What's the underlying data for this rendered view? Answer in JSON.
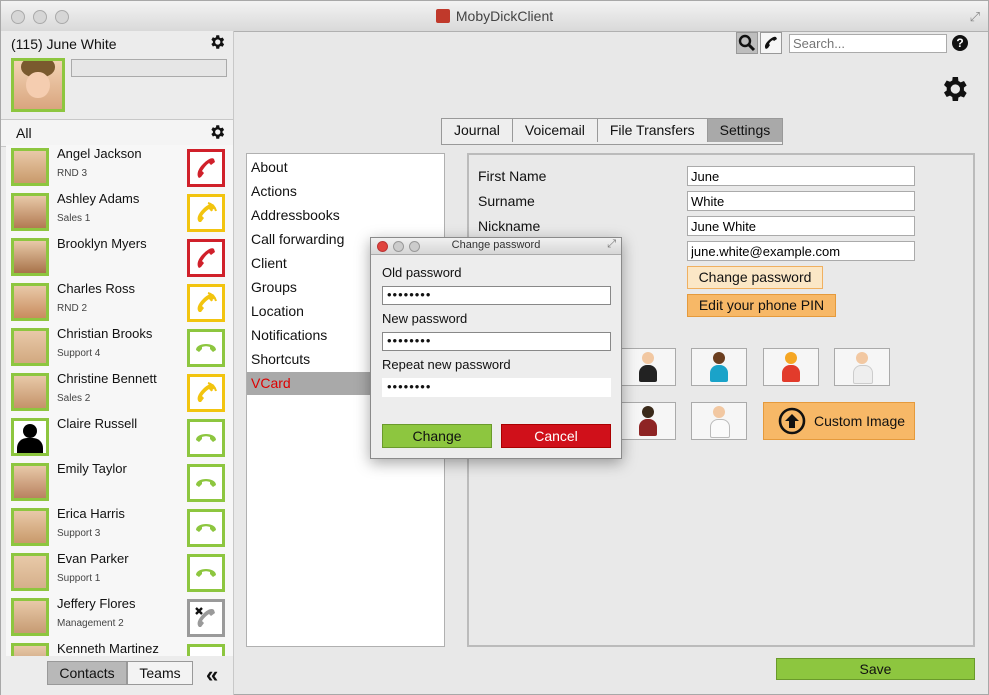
{
  "window": {
    "title": "MobyDickClient"
  },
  "user": {
    "display": "(115) June White",
    "status_value": ""
  },
  "filter": {
    "label": "All"
  },
  "contacts": [
    {
      "name": "Angel Jackson",
      "sub": "RND 3",
      "status": "busy"
    },
    {
      "name": "Ashley Adams",
      "sub": "Sales 1",
      "status": "ringing"
    },
    {
      "name": "Brooklyn Myers",
      "sub": "",
      "status": "busy"
    },
    {
      "name": "Charles Ross",
      "sub": "RND 2",
      "status": "ringing"
    },
    {
      "name": "Christian Brooks",
      "sub": "Support 4",
      "status": "available"
    },
    {
      "name": "Christine Bennett",
      "sub": "Sales 2",
      "status": "ringing"
    },
    {
      "name": "Claire Russell",
      "sub": "",
      "status": "available"
    },
    {
      "name": "Emily Taylor",
      "sub": "",
      "status": "available"
    },
    {
      "name": "Erica Harris",
      "sub": "Support 3",
      "status": "available"
    },
    {
      "name": "Evan Parker",
      "sub": "Support 1",
      "status": "available"
    },
    {
      "name": "Jeffery Flores",
      "sub": "Management 2",
      "status": "offline"
    },
    {
      "name": "Kenneth Martinez",
      "sub": "",
      "status": "available"
    }
  ],
  "bottom_tabs": {
    "contacts": "Contacts",
    "teams": "Teams",
    "collapse": "«"
  },
  "search": {
    "placeholder": "Search...",
    "help": "?"
  },
  "tabs": [
    "Journal",
    "Voicemail",
    "File Transfers",
    "Settings"
  ],
  "settings_menu": [
    "About",
    "Actions",
    "Addressbooks",
    "Call forwarding",
    "Client",
    "Groups",
    "Location",
    "Notifications",
    "Shortcuts",
    "VCard"
  ],
  "vcard": {
    "first_name_label": "First Name",
    "first_name": "June",
    "surname_label": "Surname",
    "surname": "White",
    "nickname_label": "Nickname",
    "nickname": "June White",
    "email": "june.white@example.com",
    "change_password": "Change password",
    "edit_pin": "Edit your phone PIN",
    "custom_image": "Custom Image"
  },
  "dialog": {
    "title": "Change password",
    "old_label": "Old password",
    "old_value": "••••••••",
    "new_label": "New password",
    "new_value": "••••••••",
    "repeat_label": "Repeat new password",
    "repeat_value": "••••••••",
    "change": "Change",
    "cancel": "Cancel"
  },
  "save": "Save",
  "colors": {
    "busy": "#d0202a",
    "ringing": "#f2c40f",
    "available": "#8dc63f",
    "offline": "#9a9a9a",
    "accent_orange": "#f7b867"
  }
}
